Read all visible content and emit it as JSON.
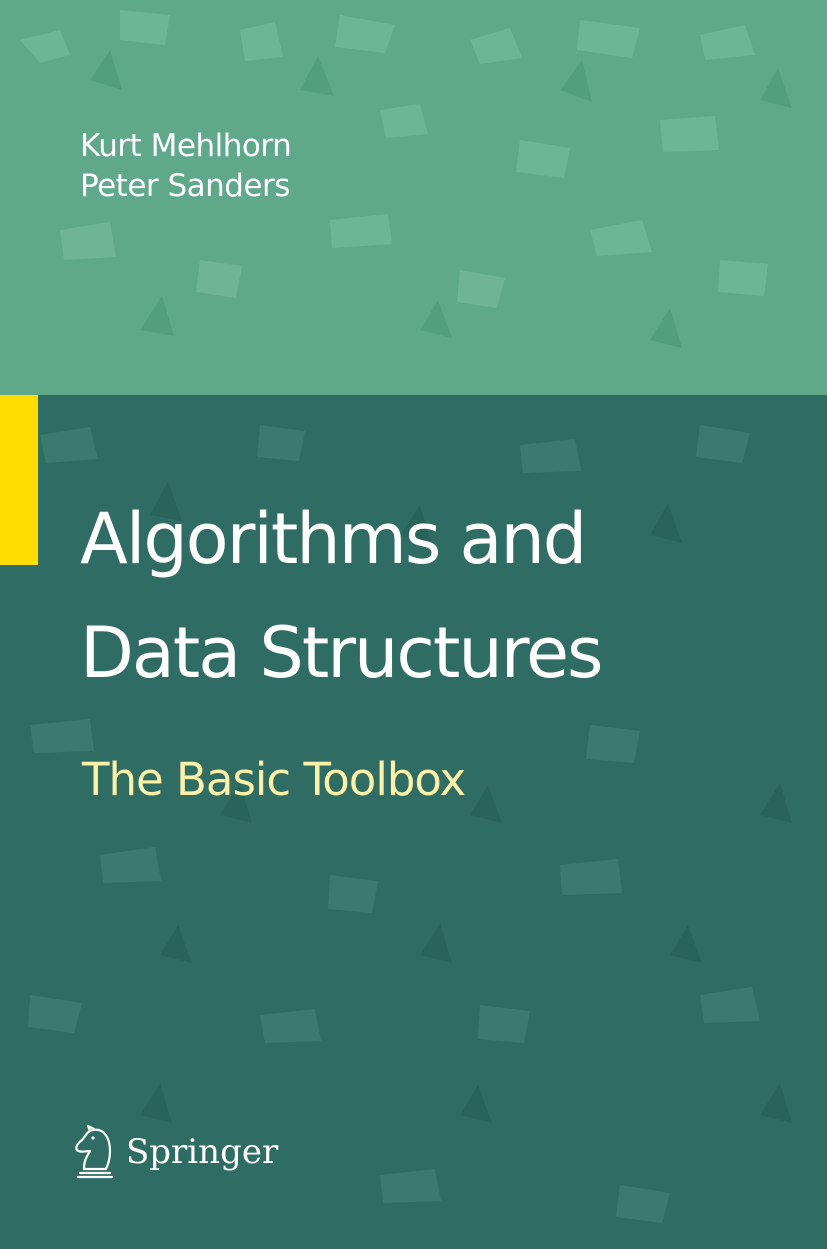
{
  "book": {
    "authors": [
      "Kurt Mehlhorn",
      "Peter Sanders"
    ],
    "title_lines": [
      "Algorithms and",
      "Data Structures"
    ],
    "subtitle": "The Basic Toolbox",
    "publisher": "Springer",
    "publisher_logo_icon": "knight-chess-piece-icon"
  },
  "colors": {
    "top_band": "#5fa889",
    "bottom_band": "#2f6d64",
    "accent_bar": "#ffdd00",
    "title_text": "#ffffff",
    "subtitle_text": "#fdf1a8"
  }
}
